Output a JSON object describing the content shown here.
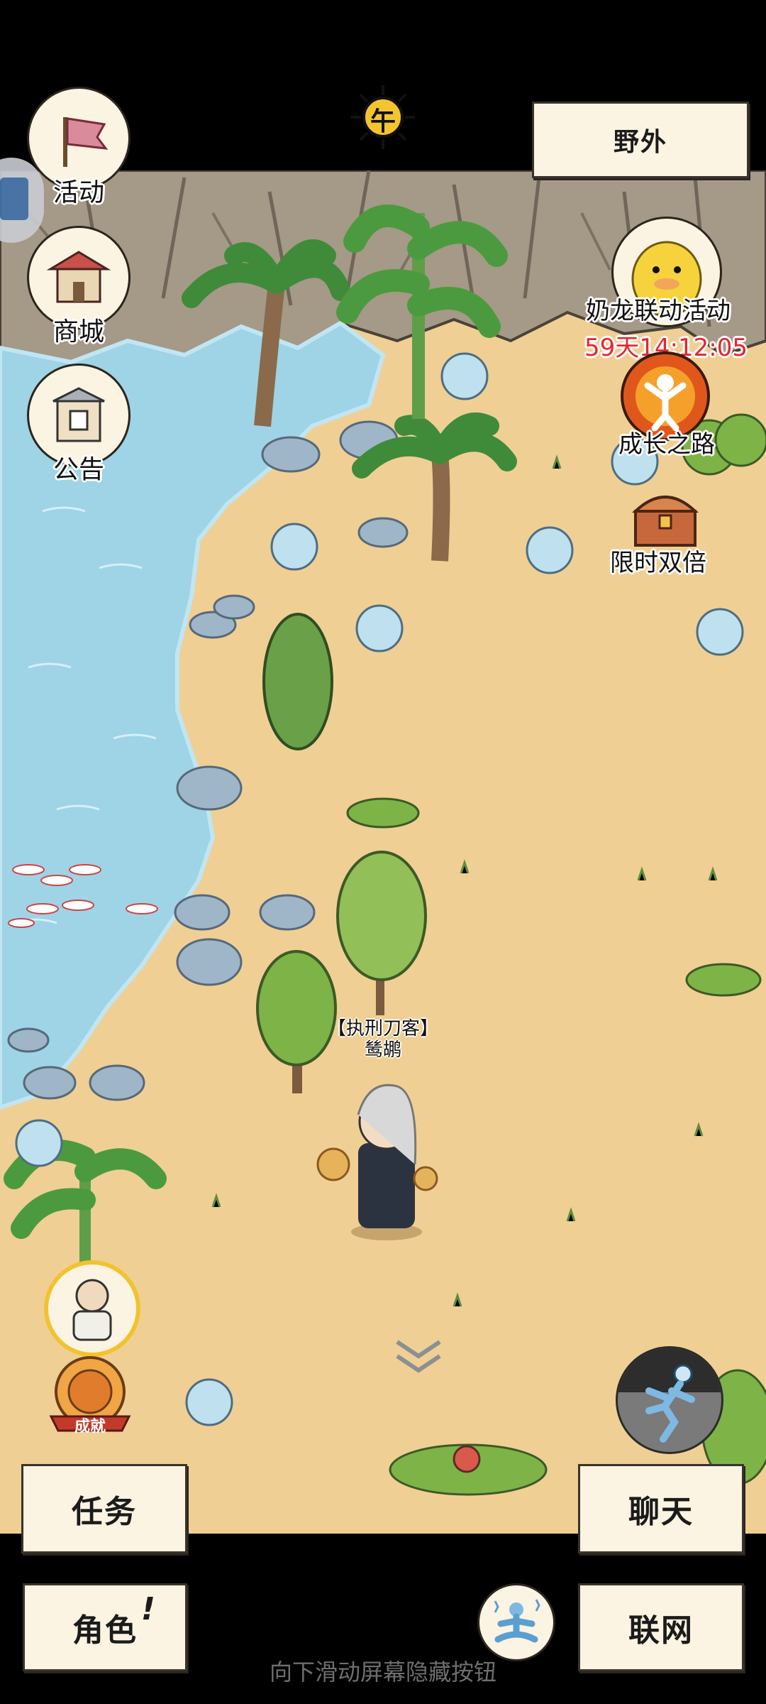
{
  "header": {
    "time_badge": "午",
    "location_button": "野外"
  },
  "left_menu": [
    {
      "label": "活动",
      "icon": "flag-icon"
    },
    {
      "label": "商城",
      "icon": "shop-icon"
    },
    {
      "label": "公告",
      "icon": "notice-board-icon"
    }
  ],
  "right_menu": {
    "event": {
      "label": "奶龙联动活动",
      "countdown": "59天14:12:05",
      "icon": "yellow-dragon-icon"
    },
    "growth": {
      "label": "成长之路",
      "icon": "growth-path-icon"
    },
    "double": {
      "label": "限时双倍",
      "icon": "treasure-chest-icon"
    }
  },
  "character": {
    "title": "【执刑刀客】",
    "name": "鸶鹕"
  },
  "achievement_badge": "成就",
  "bottom_buttons": {
    "tasks": "任务",
    "chat": "聊天",
    "role": "角色",
    "role_alert": "!",
    "network": "联网"
  },
  "hint": "向下滑动屏幕隐藏按钮",
  "colors": {
    "sand": "#f0cf94",
    "water": "#9fd3e6",
    "cliff": "#a59987",
    "paper": "#fbf4e2",
    "timer_red": "#e8242c"
  }
}
